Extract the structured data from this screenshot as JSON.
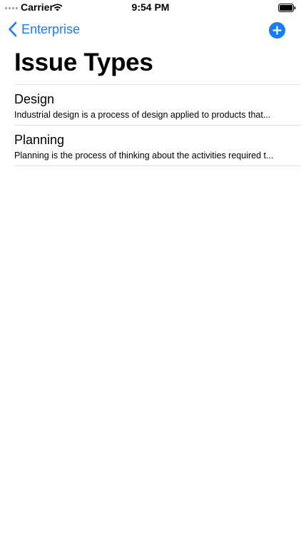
{
  "status_bar": {
    "carrier": "Carrier",
    "time": "9:54 PM"
  },
  "nav": {
    "back_label": "Enterprise",
    "accent_color": "#1a7cf2"
  },
  "page": {
    "title": "Issue Types"
  },
  "issue_types": [
    {
      "title": "Design",
      "description": "Industrial design is a process of design applied to products that..."
    },
    {
      "title": "Planning",
      "description": "Planning is the process of thinking about the activities required t..."
    }
  ]
}
